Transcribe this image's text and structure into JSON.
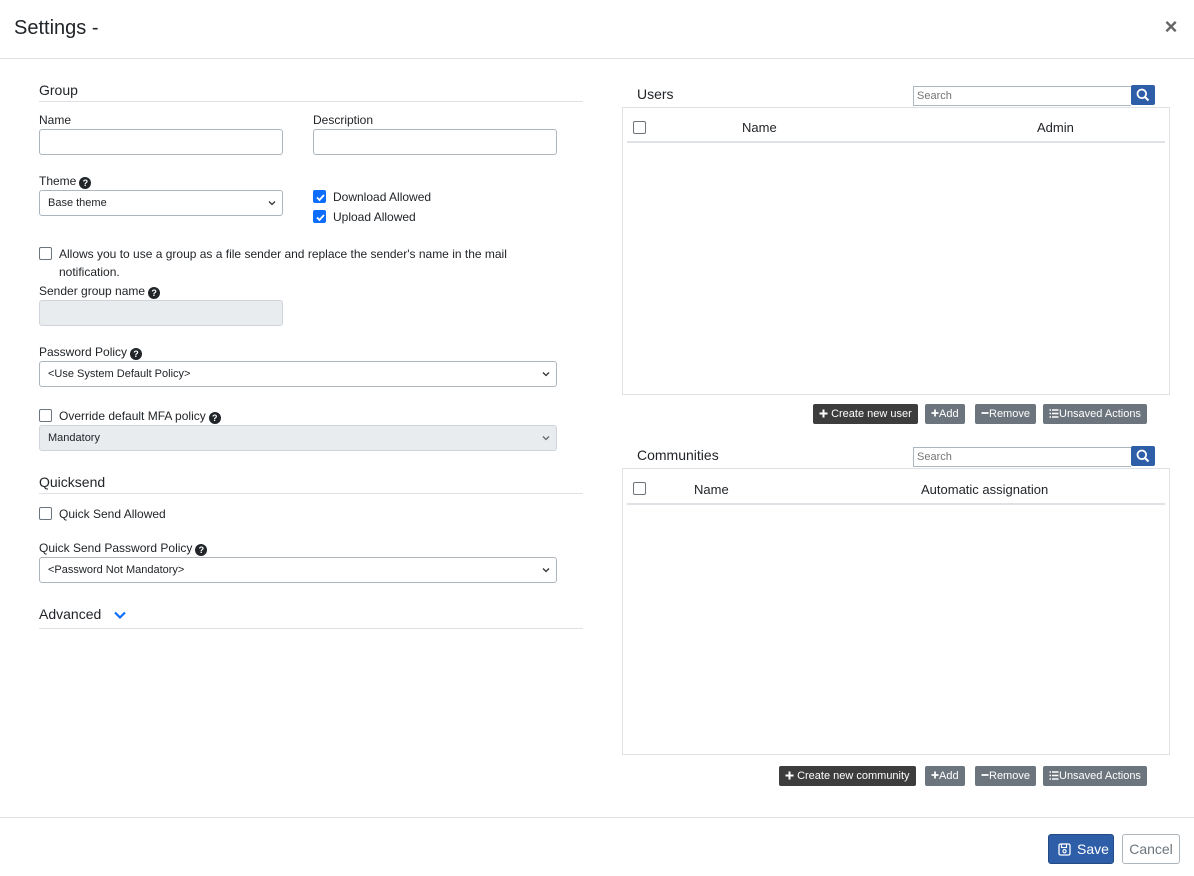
{
  "header": {
    "title": "Settings -",
    "close_glyph": "×"
  },
  "group": {
    "section_title": "Group",
    "name_label": "Name",
    "name_value": "",
    "description_label": "Description",
    "description_value": "",
    "theme_label": "Theme",
    "theme_value": "Base theme",
    "download_allowed_label": "Download Allowed",
    "download_allowed_checked": true,
    "upload_allowed_label": "Upload Allowed",
    "upload_allowed_checked": true,
    "sender_toggle_label_line1": "Allows you to use a group as a file sender and replace the sender's name in the mail",
    "sender_toggle_label_line2": "notification.",
    "sender_toggle_checked": false,
    "sender_group_name_label": "Sender group name",
    "sender_group_name_value": "",
    "password_policy_label": "Password Policy",
    "password_policy_value": "<Use System Default Policy>",
    "mfa_override_label": "Override default MFA policy",
    "mfa_override_checked": false,
    "mfa_value": "Mandatory"
  },
  "quicksend": {
    "section_title": "Quicksend",
    "allowed_label": "Quick Send Allowed",
    "allowed_checked": false,
    "password_policy_label": "Quick Send Password Policy",
    "password_policy_value": "<Password Not Mandatory>"
  },
  "advanced": {
    "section_title": "Advanced"
  },
  "users": {
    "title": "Users",
    "search_placeholder": "Search",
    "columns": [
      "Name",
      "Admin"
    ],
    "rows": [],
    "buttons": {
      "create": "Create new user",
      "add": "Add",
      "remove": "Remove",
      "unsaved": "Unsaved Actions"
    }
  },
  "communities": {
    "title": "Communities",
    "search_placeholder": "Search",
    "columns": [
      "Name",
      "Automatic assignation"
    ],
    "rows": [],
    "buttons": {
      "create": "Create new community",
      "add": "Add",
      "remove": "Remove",
      "unsaved": "Unsaved Actions"
    }
  },
  "footer": {
    "save_label": "Save",
    "cancel_label": "Cancel"
  },
  "icons": {
    "help": "question-circle-icon",
    "search": "search-icon",
    "plus": "plus-icon",
    "minus": "minus-icon",
    "list": "list-icon",
    "save": "floppy-disk-icon",
    "chevron": "chevron-down-icon"
  },
  "colors": {
    "primary": "#2f5ea8",
    "checkbox_checked": "#0d6efd",
    "dark_button": "#3d3d3d",
    "grey_button": "#6c757d"
  }
}
